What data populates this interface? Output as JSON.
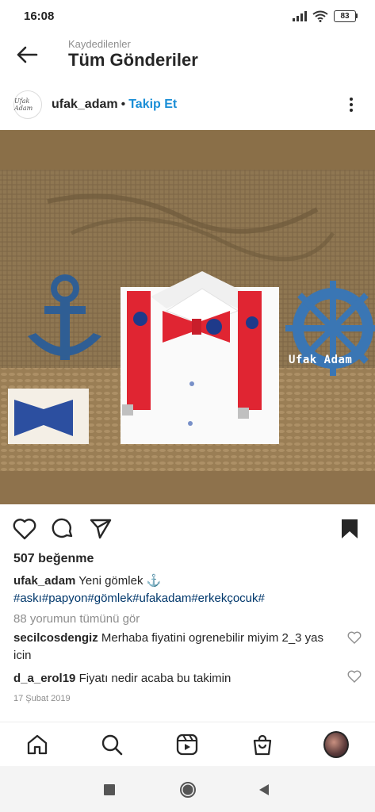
{
  "status": {
    "time": "16:08",
    "battery": "83"
  },
  "header": {
    "subtitle": "Kaydedilenler",
    "title": "Tüm Gönderiler"
  },
  "post": {
    "avatar_text": "Ufak Adam",
    "username": "ufak_adam",
    "separator": "•",
    "follow_label": "Takip Et",
    "image_watermark": "Ufak Adam",
    "likes": "507 beğenme",
    "caption_user": "ufak_adam",
    "caption_text": "Yeni gömlek ⚓",
    "hashtags": "#askı#papyon#gömlek#ufakadam#erkekçocuk#",
    "view_comments": "88 yorumun tümünü gör",
    "comments": [
      {
        "user": "secilcosdengiz",
        "text": "Merhaba fiyatini ogrenebilir miyim 2_3 yas icin"
      },
      {
        "user": "d_a_erol19",
        "text": "Fiyatı nedir acaba bu takimin"
      }
    ],
    "date": "17 Şubat 2019"
  },
  "colors": {
    "accent": "#1a8ed6",
    "hashtag": "#00376b",
    "muted": "#8e8e8e"
  }
}
